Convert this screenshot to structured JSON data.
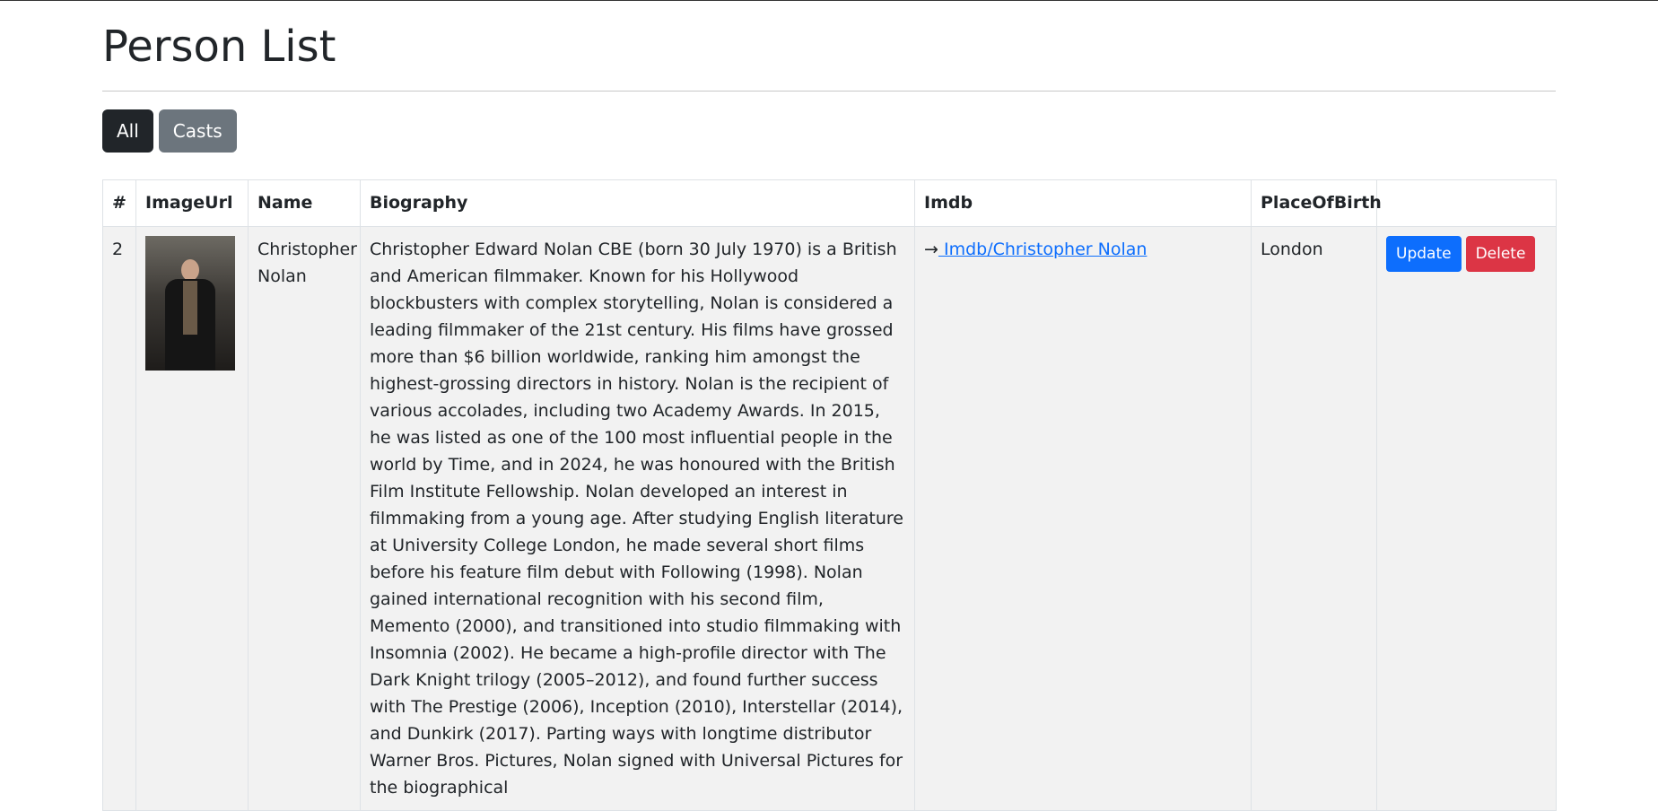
{
  "page": {
    "title": "Person List"
  },
  "filters": [
    {
      "label": "All"
    },
    {
      "label": "Casts"
    }
  ],
  "table": {
    "columns": [
      "#",
      "ImageUrl",
      "Name",
      "Biography",
      "Imdb",
      "PlaceOfBirth",
      ""
    ],
    "rows": [
      {
        "index": "2",
        "image_alt": "Christopher Nolan photo",
        "name": "Christopher Nolan",
        "biography": "Christopher Edward Nolan CBE (born 30 July 1970) is a British and American filmmaker. Known for his Hollywood blockbusters with complex storytelling, Nolan is considered a leading filmmaker of the 21st century. His films have grossed more than $6 billion worldwide, ranking him amongst the highest-grossing directors in history. Nolan is the recipient of various accolades, including two Academy Awards. In 2015, he was listed as one of the 100 most influential people in the world by Time, and in 2024, he was honoured with the British Film Institute Fellowship. Nolan developed an interest in filmmaking from a young age. After studying English literature at University College London, he made several short films before his feature film debut with Following (1998). Nolan gained international recognition with his second film, Memento (2000), and transitioned into studio filmmaking with Insomnia (2002). He became a high-profile director with The Dark Knight trilogy (2005–2012), and found further success with The Prestige (2006), Inception (2010), Interstellar (2014), and Dunkirk (2017). Parting ways with longtime distributor Warner Bros. Pictures, Nolan signed with Universal Pictures for the biographical",
        "imdb_arrow": "→",
        "imdb_link": " Imdb/Christopher Nolan",
        "place_of_birth": "London",
        "update_label": "Update",
        "delete_label": "Delete"
      }
    ]
  },
  "colors": {
    "primary": "#0d6efd",
    "danger": "#dc3545",
    "dark": "#212529",
    "secondary": "#6c757d"
  }
}
